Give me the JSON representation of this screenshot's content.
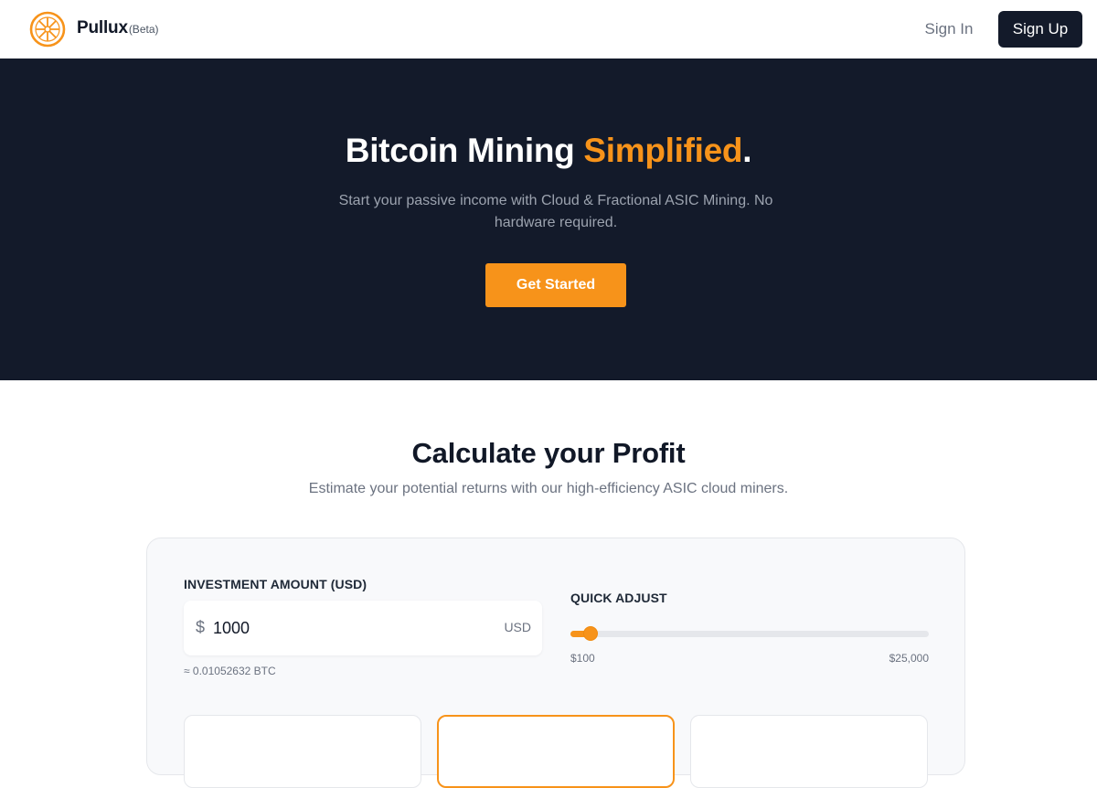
{
  "nav": {
    "brand_name": "Pullux",
    "brand_tag": "(Beta)",
    "sign_in": "Sign In",
    "sign_up": "Sign Up"
  },
  "hero": {
    "title_main": "Bitcoin Mining",
    "title_accent": "Simplified",
    "title_end": ".",
    "subtitle": "Start your passive income with Cloud & Fractional ASIC Mining. No hardware required.",
    "cta": "Get Started"
  },
  "calculator": {
    "title": "Calculate your Profit",
    "subtitle": "Estimate your potential returns with our high-efficiency ASIC cloud miners.",
    "investment_label": "INVESTMENT AMOUNT (USD)",
    "currency_symbol": "$",
    "investment_value": "1000",
    "investment_unit": "USD",
    "btc_equivalent": "≈ 0.01052632 BTC",
    "quick_adjust_label": "QUICK ADJUST",
    "slider": {
      "min": 100,
      "max": 25000,
      "value": 1000,
      "min_label": "$100",
      "max_label": "$25,000"
    }
  },
  "colors": {
    "accent": "#f7931a",
    "dark": "#131a2a"
  },
  "icons": {
    "logo": "pullux-logo-icon"
  }
}
